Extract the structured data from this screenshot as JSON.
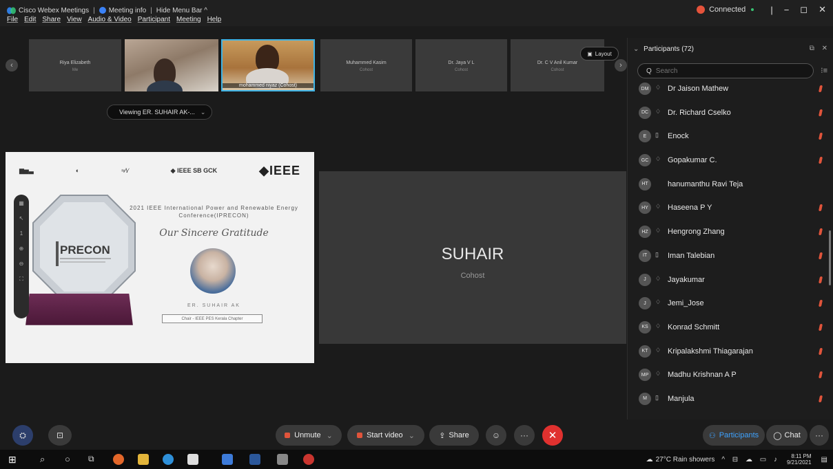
{
  "titlebar": {
    "app_title": "Cisco Webex Meetings",
    "meeting_info": "Meeting info",
    "hide_menu": "Hide Menu Bar ^",
    "status": "Connected"
  },
  "menu": [
    "File",
    "Edit",
    "Share",
    "View",
    "Audio & Video",
    "Participant",
    "Meeting",
    "Help"
  ],
  "filmstrip": {
    "tiles": [
      {
        "name": "Riya Elizabeth",
        "sub": "Me"
      },
      {
        "name": "Muhammed Kasim",
        "sub": "Cohost"
      },
      {
        "name": "Dr. Jaya V L",
        "sub": "Cohost"
      },
      {
        "name": "Dr. C V Anil Kumar",
        "sub": "Cohost"
      }
    ],
    "video_label": "mohammed niyaz (Cohost)",
    "layout_label": "Layout"
  },
  "viewing": "Viewing ER. SUHAIR AK-...",
  "slide": {
    "logo_sb": "IEEE SB GCK",
    "logo_ieee": "IEEE",
    "conference": "2021 IEEE International Power and Renewable Energy Conference(IPRECON)",
    "gratitude": "Our Sincere Gratitude",
    "brand": "PRECON",
    "speaker_name": "ER. SUHAIR AK",
    "speaker_role": "Chair - IEEE PES Kerala Chapter"
  },
  "active_speaker": {
    "name": "SUHAIR",
    "role": "Cohost"
  },
  "participants": {
    "header": "Participants (72)",
    "search_placeholder": "Search",
    "list": [
      {
        "initials": "DM",
        "name": "Dr Jaison Mathew",
        "device": "headset",
        "muted": true
      },
      {
        "initials": "DC",
        "name": "Dr. Richard Cselko",
        "device": "headset",
        "muted": true
      },
      {
        "initials": "E",
        "name": "Enock",
        "device": "phone",
        "muted": true
      },
      {
        "initials": "GC",
        "name": "Gopakumar C.",
        "device": "headset",
        "muted": true
      },
      {
        "initials": "HT",
        "name": "hanumanthu Ravi Teja",
        "device": "none",
        "muted": false
      },
      {
        "initials": "HY",
        "name": "Haseena P Y",
        "device": "headset",
        "muted": true
      },
      {
        "initials": "HZ",
        "name": "Hengrong Zhang",
        "device": "headset",
        "muted": true
      },
      {
        "initials": "IT",
        "name": "Iman Talebian",
        "device": "phone",
        "muted": true
      },
      {
        "initials": "J",
        "name": "Jayakumar",
        "device": "headset",
        "muted": true
      },
      {
        "initials": "J",
        "name": "Jemi_Jose",
        "device": "headset",
        "muted": true
      },
      {
        "initials": "KS",
        "name": "Konrad Schmitt",
        "device": "headset",
        "muted": true
      },
      {
        "initials": "KT",
        "name": "Kripalakshmi Thiagarajan",
        "device": "headset",
        "muted": true
      },
      {
        "initials": "MP",
        "name": "Madhu Krishnan A P",
        "device": "headset",
        "muted": true
      },
      {
        "initials": "M",
        "name": "Manjula",
        "device": "phone",
        "muted": true
      }
    ]
  },
  "controls": {
    "unmute": "Unmute",
    "start_video": "Start video",
    "share": "Share",
    "participants": "Participants",
    "chat": "Chat"
  },
  "taskbar": {
    "weather": "27°C Rain showers",
    "time": "8:11 PM",
    "date": "9/21/2021"
  }
}
